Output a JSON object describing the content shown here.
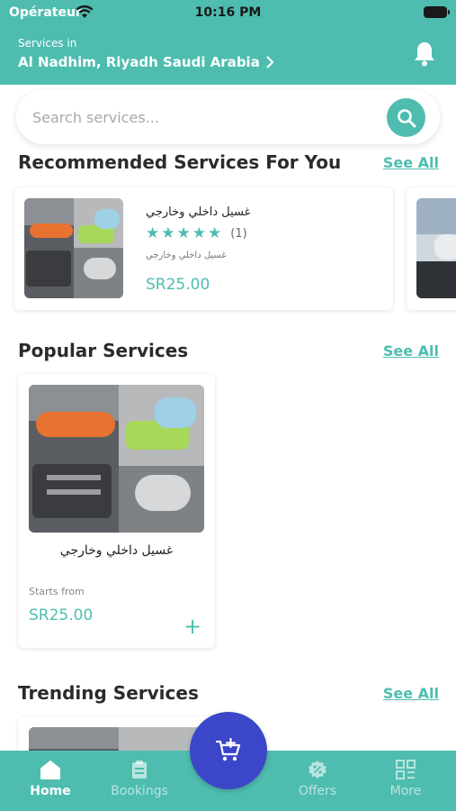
{
  "status_bar": {
    "carrier": "Opérateur",
    "time": "10:16 PM"
  },
  "header": {
    "location_caption": "Services in",
    "location_value": "Al Nadhim, Riyadh Saudi Arabia"
  },
  "search": {
    "placeholder": "Search services..."
  },
  "recommended": {
    "title": "Recommended Services For You",
    "see_all": "See All",
    "items": [
      {
        "title": "غسيل داخلي وخارجي",
        "rating_stars": 5,
        "rating_count": "(1)",
        "subtitle": "غسيل داخلي وخارجي",
        "price": "SR25.00"
      }
    ]
  },
  "popular": {
    "title": "Popular Services",
    "see_all": "See All",
    "items": [
      {
        "title": "غسيل داخلي وخارجي",
        "starts_from_label": "Starts from",
        "price": "SR25.00",
        "add_icon": "plus-icon"
      }
    ]
  },
  "trending": {
    "title": "Trending Services",
    "see_all": "See All"
  },
  "tabbar": {
    "active": "Home",
    "tabs": [
      {
        "label": "Home",
        "icon": "home-icon"
      },
      {
        "label": "Bookings",
        "icon": "clipboard-icon"
      },
      {
        "label": "Offers",
        "icon": "offers-badge-icon"
      },
      {
        "label": "More",
        "icon": "grid-icon"
      }
    ],
    "center_button_icon": "cart-plus-icon"
  },
  "colors": {
    "accent": "#4ebdb0",
    "fab": "#3b47c8"
  }
}
